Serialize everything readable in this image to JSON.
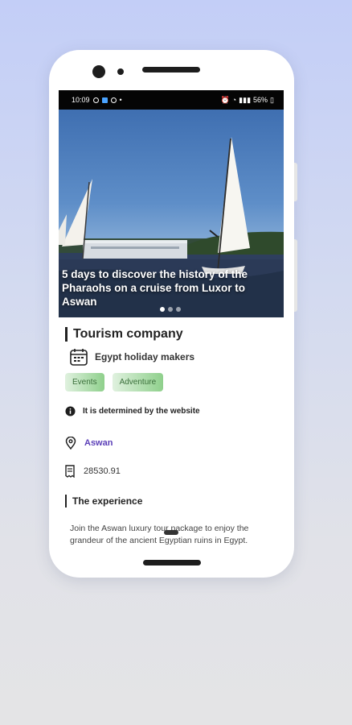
{
  "status_bar": {
    "time": "10:09",
    "battery": "56%"
  },
  "hero": {
    "title": "5 days to discover the history of the Pharaohs on a cruise from Luxor to Aswan",
    "carousel_pages": 3,
    "active_page": 1
  },
  "listing": {
    "company": "Tourism company",
    "organizer": "Egypt holiday makers",
    "tags": [
      "Events",
      "Adventure"
    ],
    "availability": "It is determined by the website",
    "location": "Aswan",
    "price": "28530.91",
    "experience_title": "The experience",
    "description": "Join the Aswan luxury tour package to enjoy the grandeur of the ancient Egyptian ruins in Egypt."
  },
  "colors": {
    "accent_purple": "#5b3fb8",
    "chip_green": "#8fd08c",
    "background_top": "#c3cef7",
    "background_bottom": "#e4e4e6"
  },
  "icons": {
    "calendar": "calendar-icon",
    "info": "info-icon",
    "location": "location-pin-icon",
    "price": "receipt-icon"
  }
}
